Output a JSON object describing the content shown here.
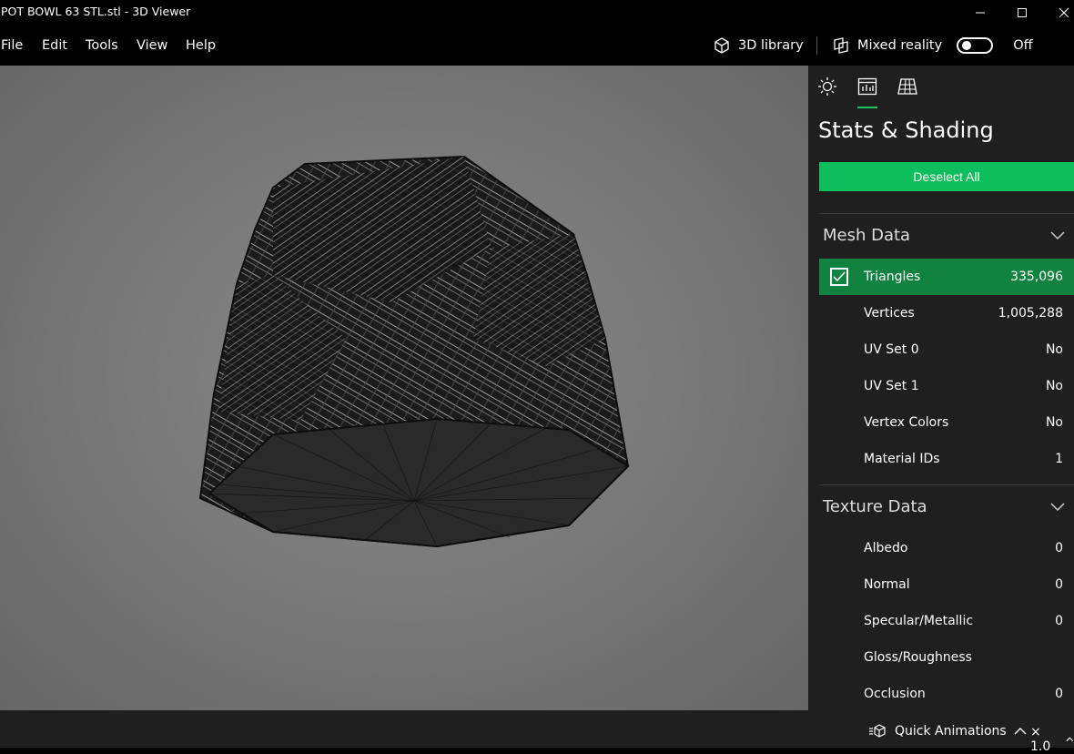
{
  "window": {
    "title": "POT BOWL 63 STL.stl - 3D Viewer"
  },
  "menu": {
    "items": [
      "File",
      "Edit",
      "Tools",
      "View",
      "Help"
    ],
    "library_label": "3D library",
    "mixed_reality_label": "Mixed reality",
    "mixed_reality_state": "Off"
  },
  "panel": {
    "tabs": [
      {
        "name": "lighting",
        "icon": "sun-icon",
        "active": false
      },
      {
        "name": "stats",
        "icon": "stats-icon",
        "active": true
      },
      {
        "name": "grid",
        "icon": "grid-icon",
        "active": false
      }
    ],
    "title": "Stats & Shading",
    "deselect_label": "Deselect All",
    "mesh": {
      "heading": "Mesh Data",
      "rows": [
        {
          "label": "Triangles",
          "value": "335,096",
          "checked": true
        },
        {
          "label": "Vertices",
          "value": "1,005,288"
        },
        {
          "label": "UV Set 0",
          "value": "No"
        },
        {
          "label": "UV Set 1",
          "value": "No"
        },
        {
          "label": "Vertex Colors",
          "value": "No"
        },
        {
          "label": "Material IDs",
          "value": "1"
        }
      ]
    },
    "texture": {
      "heading": "Texture Data",
      "rows": [
        {
          "label": "Albedo",
          "value": "0"
        },
        {
          "label": "Normal",
          "value": "0"
        },
        {
          "label": "Specular/Metallic",
          "value": "0"
        },
        {
          "label": "Gloss/Roughness",
          "value": ""
        },
        {
          "label": "Occlusion",
          "value": "0"
        }
      ]
    }
  },
  "status": {
    "quick_animations_label": "Quick Animations",
    "speed": "× 1.0"
  },
  "colors": {
    "accent": "#0ebd5b",
    "selected_row": "#11823f",
    "panel_bg": "#1f1f1f"
  }
}
